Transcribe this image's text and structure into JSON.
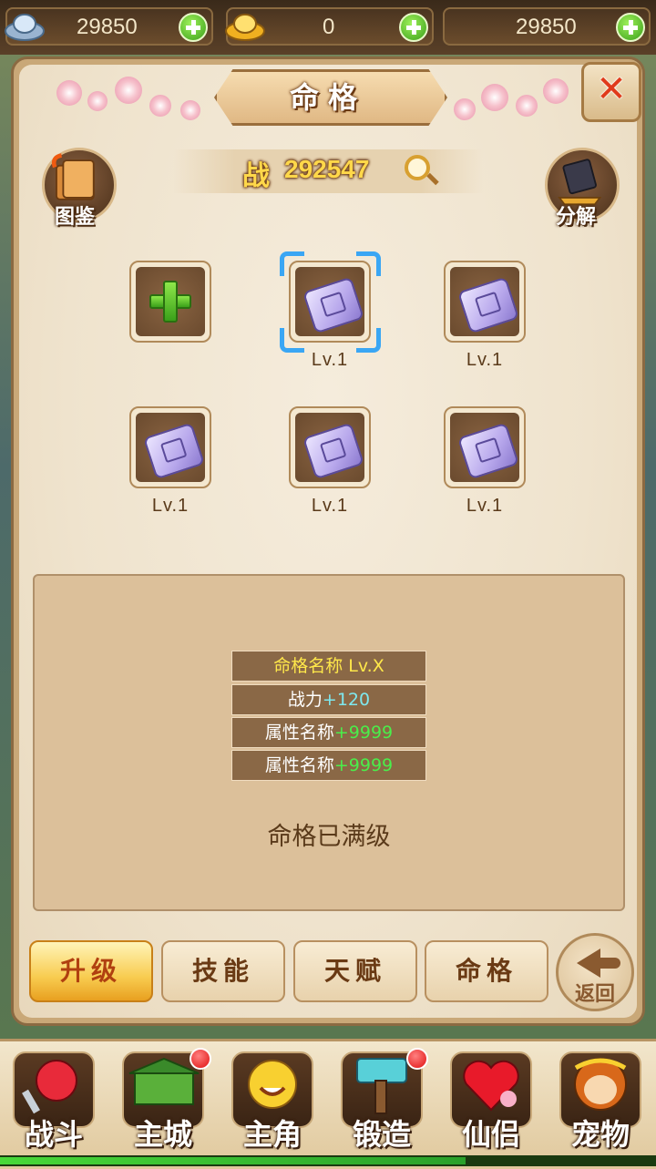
{
  "currency": [
    {
      "icon": "silver-ingot-icon",
      "value": "29850"
    },
    {
      "icon": "gold-ingot-icon",
      "value": "0"
    },
    {
      "icon": "none",
      "value": "29850"
    }
  ],
  "panel": {
    "title": "命格",
    "close_icon": "✕",
    "power_label": "战",
    "power_value": "292547",
    "left_button_label": "图鉴",
    "right_button_label": "分解"
  },
  "slots": [
    {
      "state": "empty",
      "level": ""
    },
    {
      "state": "selected",
      "level": "Lv.1"
    },
    {
      "state": "filled",
      "level": "Lv.1"
    },
    {
      "state": "filled",
      "level": "Lv.1"
    },
    {
      "state": "filled",
      "level": "Lv.1"
    },
    {
      "state": "filled",
      "level": "Lv.1"
    }
  ],
  "info": {
    "name_line": "命格名称 Lv.X",
    "power_label": "战力",
    "power_bonus": "+120",
    "attr1_label": "属性名称",
    "attr1_bonus": "+9999",
    "attr2_label": "属性名称",
    "attr2_bonus": "+9999",
    "status": "命格已满级"
  },
  "tabs": [
    {
      "label": "升级",
      "active": true
    },
    {
      "label": "技能",
      "active": false
    },
    {
      "label": "天赋",
      "active": false
    },
    {
      "label": "命格",
      "active": false
    }
  ],
  "back_label": "返回",
  "nav": [
    {
      "label": "战斗",
      "badge": false
    },
    {
      "label": "主城",
      "badge": true
    },
    {
      "label": "主角",
      "badge": false
    },
    {
      "label": "锻造",
      "badge": true
    },
    {
      "label": "仙侣",
      "badge": false
    },
    {
      "label": "宠物",
      "badge": false
    }
  ],
  "colors": {
    "accent": "#f8cc50",
    "plus_green": "#3aa01a",
    "badge_red": "#e01010",
    "selection_blue": "#3aa6f4"
  },
  "progress_fraction": 0.71
}
